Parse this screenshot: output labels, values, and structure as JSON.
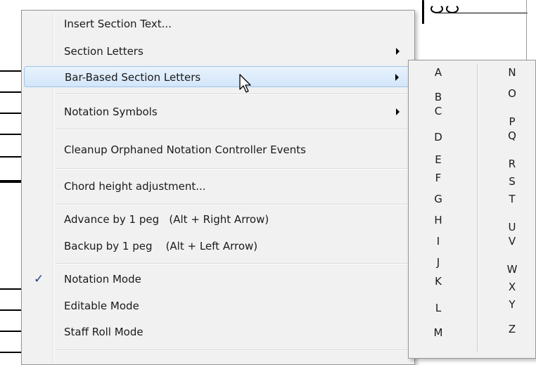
{
  "context_menu": {
    "items": [
      {
        "label": "Insert Section Text...",
        "submenu": false
      },
      {
        "label": "Section Letters",
        "submenu": true
      },
      {
        "label": "Bar-Based Section Letters",
        "submenu": true,
        "highlighted": true
      },
      {
        "label": "Notation Symbols",
        "submenu": true
      },
      {
        "label": "Cleanup Orphaned Notation Controller Events",
        "submenu": false
      },
      {
        "label": "Chord height adjustment...",
        "submenu": false
      },
      {
        "label": "Advance by 1 peg   (Alt + Right Arrow)",
        "submenu": false
      },
      {
        "label": "Backup by 1 peg    (Alt + Left Arrow)",
        "submenu": false
      },
      {
        "label": "Notation Mode",
        "submenu": false,
        "checked": true
      },
      {
        "label": "Editable Mode",
        "submenu": false
      },
      {
        "label": "Staff Roll Mode",
        "submenu": false
      }
    ],
    "check_glyph": "✓"
  },
  "submenu": {
    "left_column": [
      "A",
      "B",
      "C",
      "D",
      "E",
      "F",
      "G",
      "H",
      "I",
      "J",
      "K",
      "L",
      "M"
    ],
    "right_column": [
      "N",
      "O",
      "P",
      "Q",
      "R",
      "S",
      "T",
      "U",
      "V",
      "W",
      "X",
      "Y",
      "Z"
    ]
  },
  "colors": {
    "highlight_bg": "#d2e6fa",
    "highlight_border": "#9ec3e8",
    "check": "#1b3f86",
    "menu_bg": "#f1f1f1"
  }
}
